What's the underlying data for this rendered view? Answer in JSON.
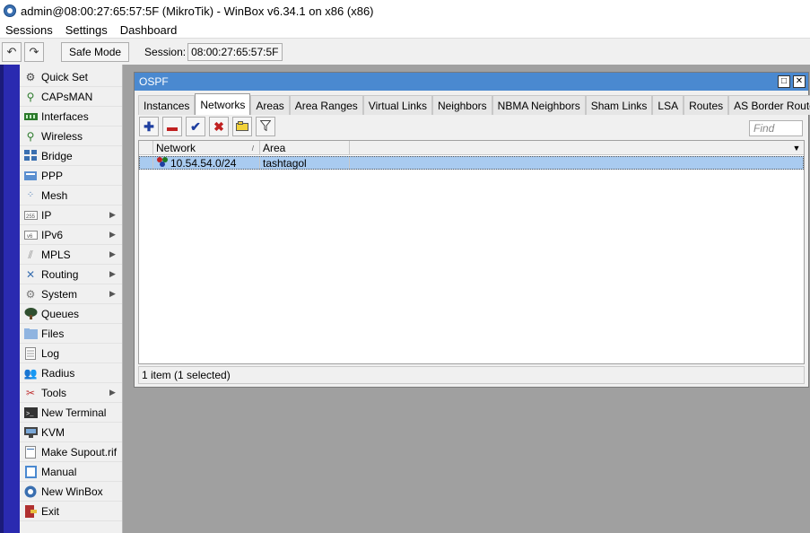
{
  "titlebar": {
    "title": "admin@08:00:27:65:57:5F (MikroTik) - WinBox v6.34.1 on x86 (x86)"
  },
  "menubar": {
    "items": [
      "Sessions",
      "Settings",
      "Dashboard"
    ]
  },
  "toolbar": {
    "undo_icon": "undo-icon",
    "redo_icon": "redo-icon",
    "safe_mode_label": "Safe Mode",
    "session_label": "Session:",
    "session_value": "08:00:27:65:57:5F"
  },
  "sidebar": {
    "items": [
      {
        "label": "Quick Set",
        "icon": "quickset-icon",
        "submenu": false
      },
      {
        "label": "CAPsMAN",
        "icon": "capsman-icon",
        "submenu": false
      },
      {
        "label": "Interfaces",
        "icon": "interfaces-icon",
        "submenu": false
      },
      {
        "label": "Wireless",
        "icon": "wireless-icon",
        "submenu": false
      },
      {
        "label": "Bridge",
        "icon": "bridge-icon",
        "submenu": false
      },
      {
        "label": "PPP",
        "icon": "ppp-icon",
        "submenu": false
      },
      {
        "label": "Mesh",
        "icon": "mesh-icon",
        "submenu": false
      },
      {
        "label": "IP",
        "icon": "ip-icon",
        "submenu": true
      },
      {
        "label": "IPv6",
        "icon": "ipv6-icon",
        "submenu": true
      },
      {
        "label": "MPLS",
        "icon": "mpls-icon",
        "submenu": true
      },
      {
        "label": "Routing",
        "icon": "routing-icon",
        "submenu": true
      },
      {
        "label": "System",
        "icon": "system-icon",
        "submenu": true
      },
      {
        "label": "Queues",
        "icon": "queues-icon",
        "submenu": false
      },
      {
        "label": "Files",
        "icon": "files-icon",
        "submenu": false
      },
      {
        "label": "Log",
        "icon": "log-icon",
        "submenu": false
      },
      {
        "label": "Radius",
        "icon": "radius-icon",
        "submenu": false
      },
      {
        "label": "Tools",
        "icon": "tools-icon",
        "submenu": true
      },
      {
        "label": "New Terminal",
        "icon": "terminal-icon",
        "submenu": false
      },
      {
        "label": "KVM",
        "icon": "kvm-icon",
        "submenu": false
      },
      {
        "label": "Make Supout.rif",
        "icon": "supout-icon",
        "submenu": false
      },
      {
        "label": "Manual",
        "icon": "manual-icon",
        "submenu": false
      },
      {
        "label": "New WinBox",
        "icon": "winbox-icon",
        "submenu": false
      },
      {
        "label": "Exit",
        "icon": "exit-icon",
        "submenu": false
      }
    ]
  },
  "ospf_window": {
    "title": "OSPF",
    "tabs": [
      {
        "label": "Instances",
        "active": false
      },
      {
        "label": "Networks",
        "active": true
      },
      {
        "label": "Areas",
        "active": false
      },
      {
        "label": "Area Ranges",
        "active": false
      },
      {
        "label": "Virtual Links",
        "active": false
      },
      {
        "label": "Neighbors",
        "active": false
      },
      {
        "label": "NBMA Neighbors",
        "active": false
      },
      {
        "label": "Sham Links",
        "active": false
      },
      {
        "label": "LSA",
        "active": false
      },
      {
        "label": "Routes",
        "active": false
      },
      {
        "label": "AS Border Routers",
        "active": false
      },
      {
        "label": "...",
        "active": false
      }
    ],
    "find_placeholder": "Find",
    "table": {
      "columns": [
        "Network",
        "Area"
      ],
      "rows": [
        {
          "network": "10.54.54.0/24",
          "area": "tashtagol",
          "selected": true
        }
      ]
    },
    "status": "1 item (1 selected)"
  },
  "colors": {
    "left_strip": "#2a2ab0",
    "window_title": "#4a89d0",
    "selected_row": "#a9cbf0",
    "workarea": "#a0a0a0"
  }
}
